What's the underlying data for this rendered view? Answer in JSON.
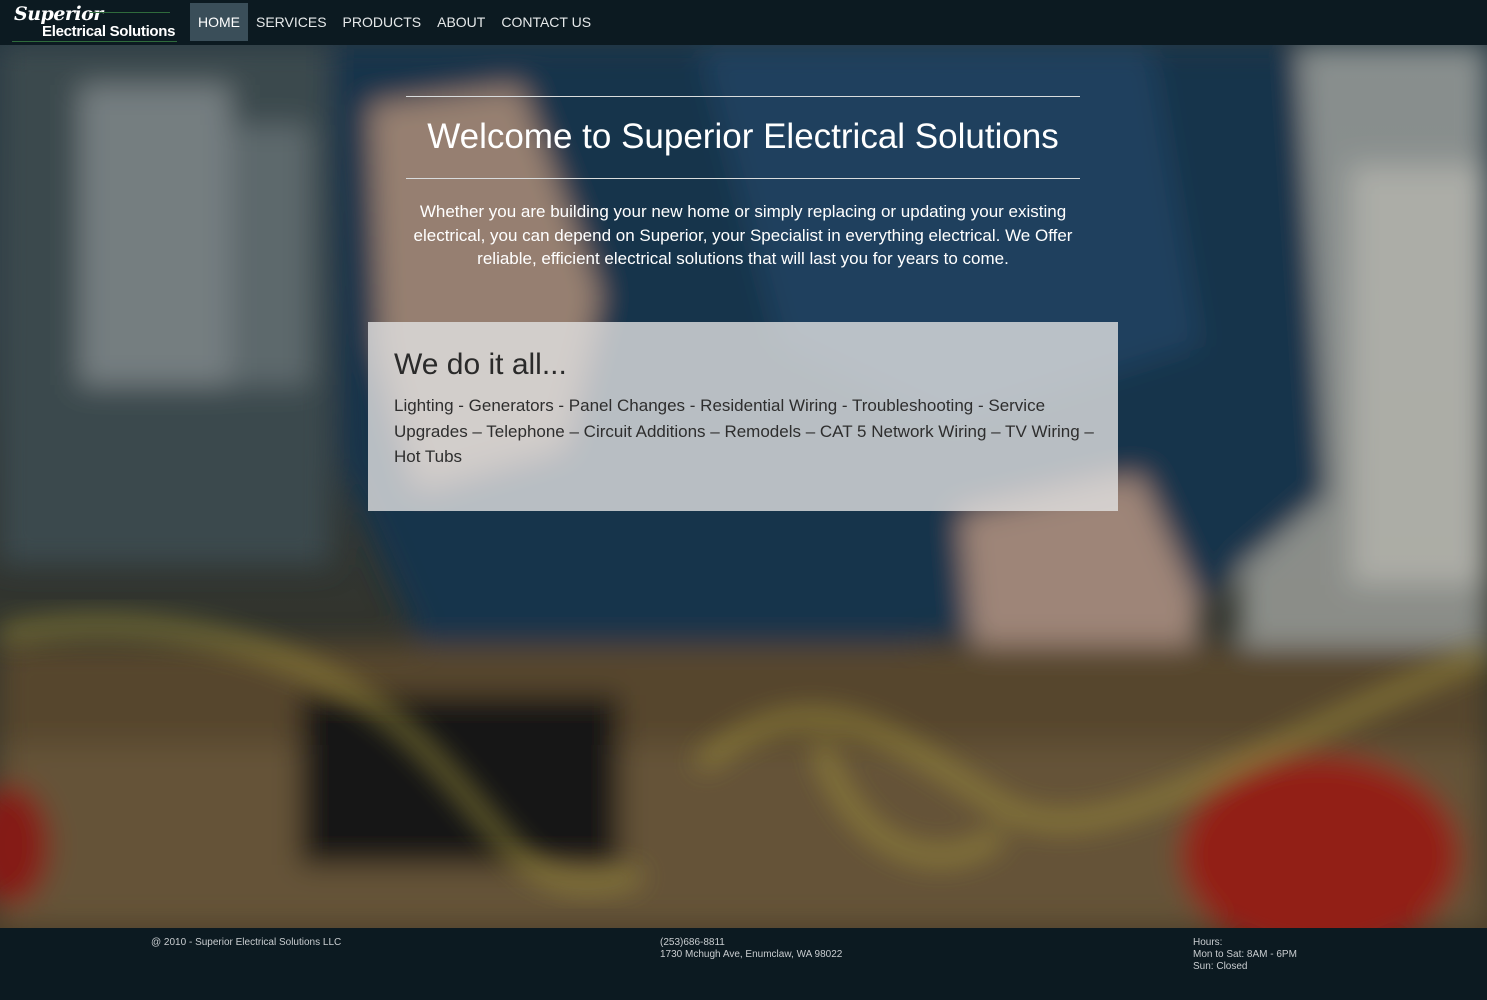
{
  "nav": {
    "logo": {
      "top_text": "Superior",
      "bottom_text": "Electrical Solutions"
    },
    "links": [
      {
        "label": "HOME",
        "active": true
      },
      {
        "label": "SERVICES",
        "active": false
      },
      {
        "label": "PRODUCTS",
        "active": false
      },
      {
        "label": "ABOUT",
        "active": false
      },
      {
        "label": "CONTACT US",
        "active": false
      }
    ]
  },
  "hero": {
    "title": "Welcome to Superior Electrical Solutions",
    "intro": "Whether you are building your new home or simply replacing or updating your existing electrical, you can depend on Superior, your Specialist in everything electrical. We Offer reliable, efficient electrical solutions that will last you for years to come.",
    "services_title": "We do it all...",
    "services_list": "Lighting - Generators - Panel Changes - Residential Wiring - Troubleshooting - Service Upgrades – Telephone – Circuit Additions – Remodels – CAT 5 Network Wiring – TV Wiring – Hot Tubs"
  },
  "footer": {
    "copyright": "@ 2010 - Superior Electrical Solutions LLC",
    "phone": "(253)686-8811",
    "address": "1730 Mchugh Ave, Enumclaw, WA 98022",
    "hours_label": "Hours:",
    "hours_weekday": "Mon to Sat: 8AM - 6PM",
    "hours_sunday": "Sun: Closed"
  },
  "colors": {
    "navbar_bg": "#0c1a21",
    "active_nav_bg": "#3a4e59",
    "footer_bg": "#0c1a21",
    "services_box_bg": "#e1e1e1"
  },
  "icons": {
    "hero_background": "electrician-working-photo"
  }
}
